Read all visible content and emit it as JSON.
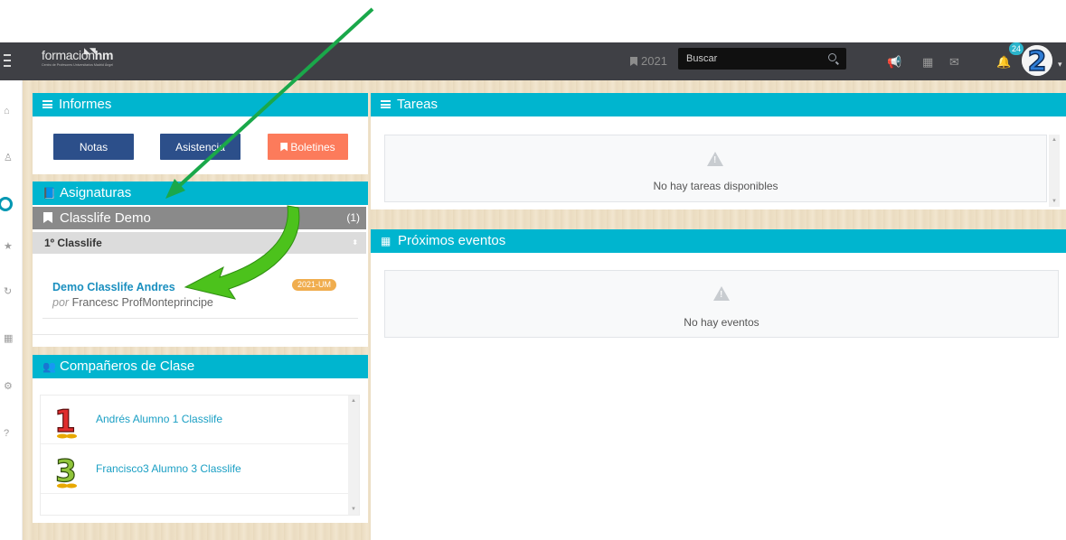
{
  "header": {
    "logo": {
      "brand_light": "formación",
      "brand_bold": "hm",
      "tagline": "Centro de Profesores Universitarios Madrid Ángel"
    },
    "year_label": "2021",
    "search_placeholder": "Buscar",
    "notification_count": "24",
    "avatar_number": "2"
  },
  "informes": {
    "title": "Informes",
    "buttons": {
      "notas": "Notas",
      "asistencia": "Asistencia",
      "boletines": "Boletines"
    }
  },
  "asignaturas": {
    "title": "Asignaturas",
    "group_title": "Classlife Demo",
    "group_count": "(1)",
    "subgroup": "1º Classlife",
    "course": {
      "name": "Demo Classlife Andres",
      "by_prefix": "por",
      "teacher": "Francesc ProfMonteprincipe",
      "tag": "2021-UM"
    }
  },
  "companeros": {
    "title": "Compañeros de Clase",
    "students": [
      {
        "badge": "1",
        "name": "Andrés Alumno 1 Classlife"
      },
      {
        "badge": "3",
        "name": "Francisco3 Alumno 3 Classlife"
      }
    ]
  },
  "tareas": {
    "title": "Tareas",
    "empty": "No hay tareas disponibles"
  },
  "eventos": {
    "title": "Próximos eventos",
    "empty": "No hay eventos"
  },
  "colors": {
    "header_bg": "#3f4045",
    "panel_accent": "#00b5cf",
    "button_blue": "#2c4f8a",
    "button_orange": "#fc7b5b",
    "arrow_green": "#2db34a",
    "tag_orange": "#f0ad4e",
    "link": "#1a8fbf"
  }
}
